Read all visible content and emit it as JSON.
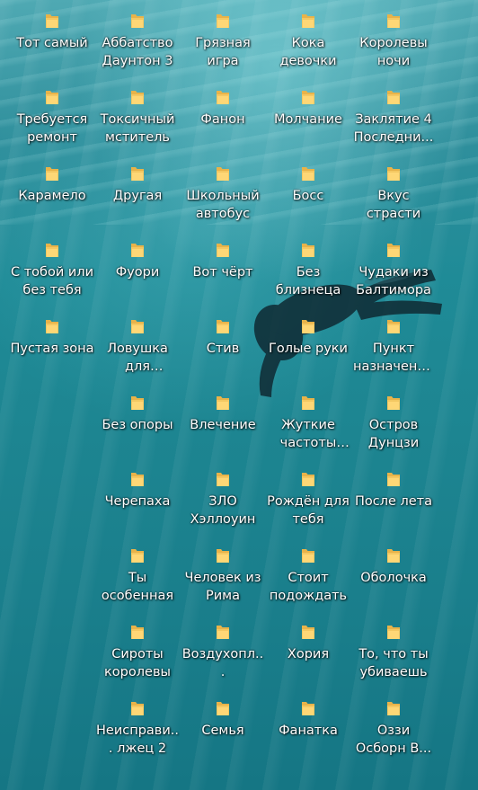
{
  "desktop": {
    "icons": [
      {
        "label": "Тот самый",
        "icon": "folder-icon"
      },
      {
        "label": "Аббатство Даунтон 3",
        "icon": "folder-icon"
      },
      {
        "label": "Грязная игра",
        "icon": "folder-icon"
      },
      {
        "label": "Кока девочки",
        "icon": "folder-icon"
      },
      {
        "label": "Королевы ночи",
        "icon": "folder-icon"
      },
      {
        "label": "Требуется ремонт",
        "icon": "folder-icon"
      },
      {
        "label": "Токсичный мститель",
        "icon": "folder-icon"
      },
      {
        "label": "Фанон",
        "icon": "folder-icon"
      },
      {
        "label": "Молчание",
        "icon": "folder-icon"
      },
      {
        "label": "Заклятие 4 Последни...",
        "icon": "folder-icon"
      },
      {
        "label": "Карамело",
        "icon": "folder-icon"
      },
      {
        "label": "Другая",
        "icon": "folder-icon"
      },
      {
        "label": "Школьный автобус",
        "icon": "folder-icon"
      },
      {
        "label": "Босс",
        "icon": "folder-icon"
      },
      {
        "label": "Вкус страсти",
        "icon": "folder-icon"
      },
      {
        "label": "С тобой или без тебя",
        "icon": "folder-icon"
      },
      {
        "label": "Фуори",
        "icon": "folder-icon"
      },
      {
        "label": "Вот чёрт",
        "icon": "folder-icon"
      },
      {
        "label": "Без близнеца",
        "icon": "folder-icon"
      },
      {
        "label": "Чудаки из Балтимора",
        "icon": "folder-icon"
      },
      {
        "label": "Пустая зона",
        "icon": "folder-icon"
      },
      {
        "label": "Ловушка для кролика",
        "icon": "folder-icon"
      },
      {
        "label": "Стив",
        "icon": "folder-icon"
      },
      {
        "label": "Голые руки",
        "icon": "folder-icon"
      },
      {
        "label": "Пункт назначени...",
        "icon": "folder-icon"
      },
      {
        "label": "Без опоры",
        "icon": "folder-icon"
      },
      {
        "label": "Влечение",
        "icon": "folder-icon"
      },
      {
        "label": "Жуткие частоты Та...",
        "icon": "folder-icon"
      },
      {
        "label": "Остров Дунцзи",
        "icon": "folder-icon"
      },
      {
        "label": "Черепаха",
        "icon": "folder-icon"
      },
      {
        "label": "ЗЛО Хэллоуин",
        "icon": "folder-icon"
      },
      {
        "label": "Рождён для тебя",
        "icon": "folder-icon"
      },
      {
        "label": "После лета",
        "icon": "folder-icon"
      },
      {
        "label": "Ты особенная",
        "icon": "folder-icon"
      },
      {
        "label": "Человек из Рима",
        "icon": "folder-icon"
      },
      {
        "label": "Стоит подождать",
        "icon": "folder-icon"
      },
      {
        "label": "Оболочка",
        "icon": "folder-icon"
      },
      {
        "label": "Сироты королевы",
        "icon": "folder-icon"
      },
      {
        "label": "Воздухопл...",
        "icon": "folder-icon"
      },
      {
        "label": "Хория",
        "icon": "folder-icon"
      },
      {
        "label": "То, что ты убиваешь",
        "icon": "folder-icon"
      },
      {
        "label": "Неисправи... лжец 2",
        "icon": "folder-icon"
      },
      {
        "label": "Семья",
        "icon": "folder-icon"
      },
      {
        "label": "Фанатка",
        "icon": "folder-icon"
      },
      {
        "label": "Оззи Осборн В...",
        "icon": "folder-icon"
      }
    ]
  },
  "colors": {
    "folder_body": "#f4c862",
    "folder_tab": "#e8b34a",
    "folder_front": "#ffd97a",
    "label_text": "#ffffff"
  }
}
